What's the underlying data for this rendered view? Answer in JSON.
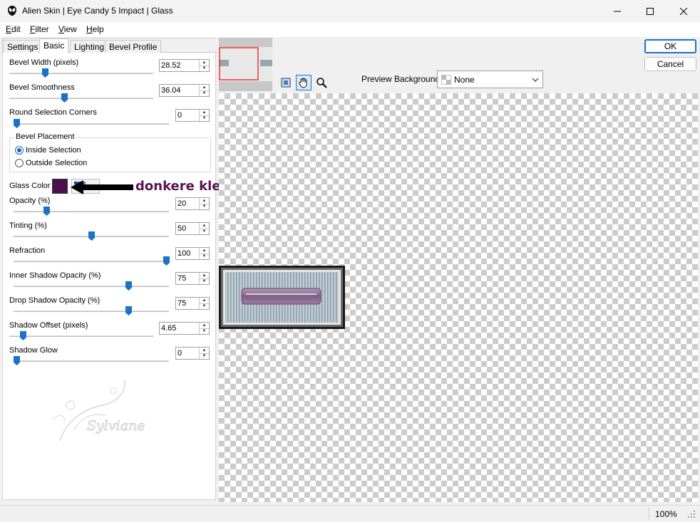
{
  "window": {
    "title": "Alien Skin | Eye Candy 5 Impact | Glass"
  },
  "menu": {
    "items": [
      {
        "letter": "E",
        "rest": "dit"
      },
      {
        "letter": "F",
        "rest": "ilter"
      },
      {
        "letter": "V",
        "rest": "iew"
      },
      {
        "letter": "H",
        "rest": "elp"
      }
    ]
  },
  "tabs": [
    "Settings",
    "Basic",
    "Lighting",
    "Bevel Profile"
  ],
  "controls": {
    "bevel_width": {
      "label": "Bevel Width (pixels)",
      "value": "28.52"
    },
    "bevel_smoothness": {
      "label": "Bevel Smoothness",
      "value": "36.04"
    },
    "round_corners": {
      "label": "Round Selection Corners",
      "value": "0"
    },
    "bevel_placement": {
      "legend": "Bevel Placement",
      "inside": "Inside Selection",
      "outside": "Outside Selection",
      "selected": "inside"
    },
    "glass_color": {
      "label": "Glass Color",
      "color": "#4a0f4e"
    },
    "opacity": {
      "label": "Opacity (%)",
      "value": "20"
    },
    "tinting": {
      "label": "Tinting (%)",
      "value": "50"
    },
    "refraction": {
      "label": "Refraction",
      "value": "100"
    },
    "inner_shadow": {
      "label": "Inner Shadow Opacity (%)",
      "value": "75"
    },
    "drop_shadow": {
      "label": "Drop Shadow Opacity (%)",
      "value": "75"
    },
    "shadow_offset": {
      "label": "Shadow Offset (pixels)",
      "value": "4.65"
    },
    "shadow_glow": {
      "label": "Shadow Glow",
      "value": "0"
    }
  },
  "annotation": {
    "text": "donkere kleur"
  },
  "watermark": {
    "text": "Sylviane"
  },
  "buttons": {
    "ok": "OK",
    "cancel": "Cancel"
  },
  "preview": {
    "background_label": "Preview Background:",
    "background_value": "None"
  },
  "status": {
    "zoom": "100%"
  },
  "colors": {
    "accent": "#1a73c7",
    "annotation": "#5a1352"
  }
}
